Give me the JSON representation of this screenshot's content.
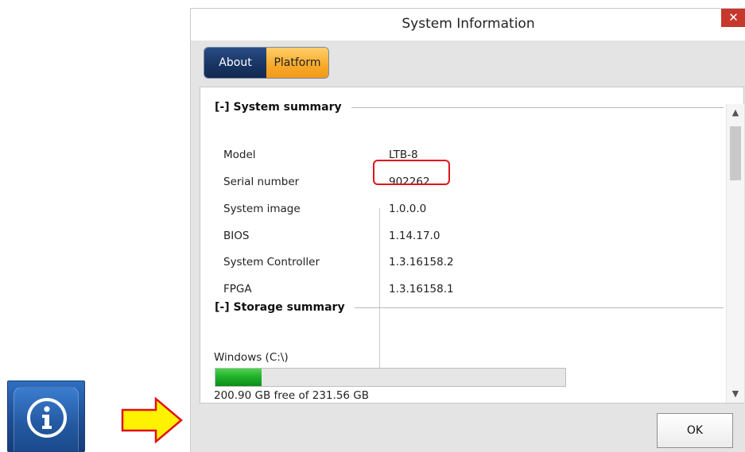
{
  "dialog": {
    "title": "System Information",
    "close_symbol": "✕",
    "ok_label": "OK"
  },
  "tabs": [
    {
      "label": "About",
      "selected": false
    },
    {
      "label": "Platform",
      "selected": true
    }
  ],
  "system_summary": {
    "header": "[-] System summary",
    "rows": [
      {
        "label": "Model",
        "value": "LTB-8"
      },
      {
        "label": "Serial number",
        "value": "902262"
      },
      {
        "label": "System image",
        "value": "1.0.0.0"
      },
      {
        "label": "BIOS",
        "value": "1.14.17.0"
      },
      {
        "label": "System Controller",
        "value": "1.3.16158.2"
      },
      {
        "label": "FPGA",
        "value": "1.3.16158.1"
      }
    ]
  },
  "storage_summary": {
    "header": "[-] Storage summary",
    "drive_label": "Windows (C:\\)",
    "free_text": "200.90 GB free of 231.56 GB",
    "used_fraction": 0.1324
  },
  "icons": {
    "info": "info-icon",
    "arrow": "arrow-right-icon",
    "close": "close-icon"
  },
  "colors": {
    "tab_about": "#173462",
    "tab_platform": "#f7a92a",
    "highlight": "#e0141d",
    "storage_fill": "#1fae2a",
    "close_button": "#c7382c"
  }
}
